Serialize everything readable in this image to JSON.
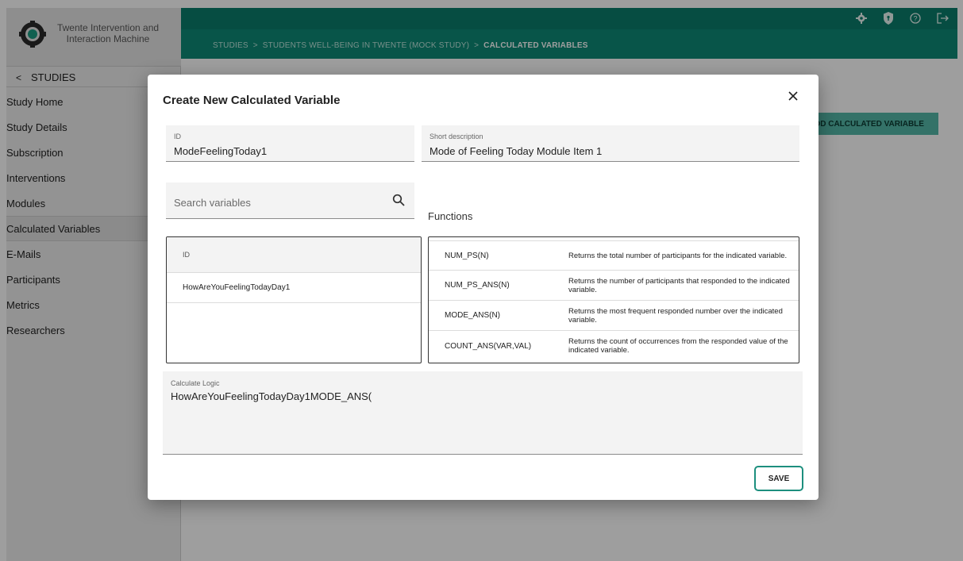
{
  "app": {
    "name_line1": "Twente Intervention and",
    "name_line2": "Interaction Machine"
  },
  "breadcrumb": {
    "items": [
      "STUDIES",
      "STUDENTS WELL-BEING IN TWENTE (MOCK STUDY)"
    ],
    "separator": ">",
    "current": "CALCULATED VARIABLES"
  },
  "sidebar": {
    "back_label": "STUDIES",
    "items": [
      {
        "label": "Study Home"
      },
      {
        "label": "Study Details"
      },
      {
        "label": "Subscription"
      },
      {
        "label": "Interventions"
      },
      {
        "label": "Modules"
      },
      {
        "label": "Calculated Variables",
        "active": true
      },
      {
        "label": "E-Mails"
      },
      {
        "label": "Participants"
      },
      {
        "label": "Metrics"
      },
      {
        "label": "Researchers"
      }
    ]
  },
  "header_icons": [
    "gear-icon",
    "shield-icon",
    "help-icon",
    "logout-icon"
  ],
  "page": {
    "add_button_label": "DD CALCULATED VARIABLE"
  },
  "modal": {
    "title": "Create New Calculated Variable",
    "id_field": {
      "label": "ID",
      "value": "ModeFeelingToday1"
    },
    "desc_field": {
      "label": "Short description",
      "value": "Mode of Feeling Today Module Item 1"
    },
    "search": {
      "placeholder": "Search variables"
    },
    "functions_label": "Functions",
    "variables_table": {
      "header": "ID",
      "rows": [
        "HowAreYouFeelingTodayDay1"
      ]
    },
    "functions": [
      {
        "name": "NUM_PS(N)",
        "description": "Returns the total number of participants for the indicated variable."
      },
      {
        "name": "NUM_PS_ANS(N)",
        "description": "Returns the number of participants that responded to the indicated variable."
      },
      {
        "name": "MODE_ANS(N)",
        "description": "Returns the most frequent responded number over the indicated variable."
      },
      {
        "name": "COUNT_ANS(VAR,VAL)",
        "description": "Returns the count of occurrences from the responded value of the indicated variable."
      }
    ],
    "logic": {
      "label": "Calculate Logic",
      "value": "HowAreYouFeelingTodayDay1MODE_ANS("
    },
    "save_label": "SAVE"
  },
  "colors": {
    "primary": "#0e8a76",
    "primary_dark": "#0b7d6b",
    "button_border": "#1d8f7e",
    "add_button": "#55b8a8"
  }
}
